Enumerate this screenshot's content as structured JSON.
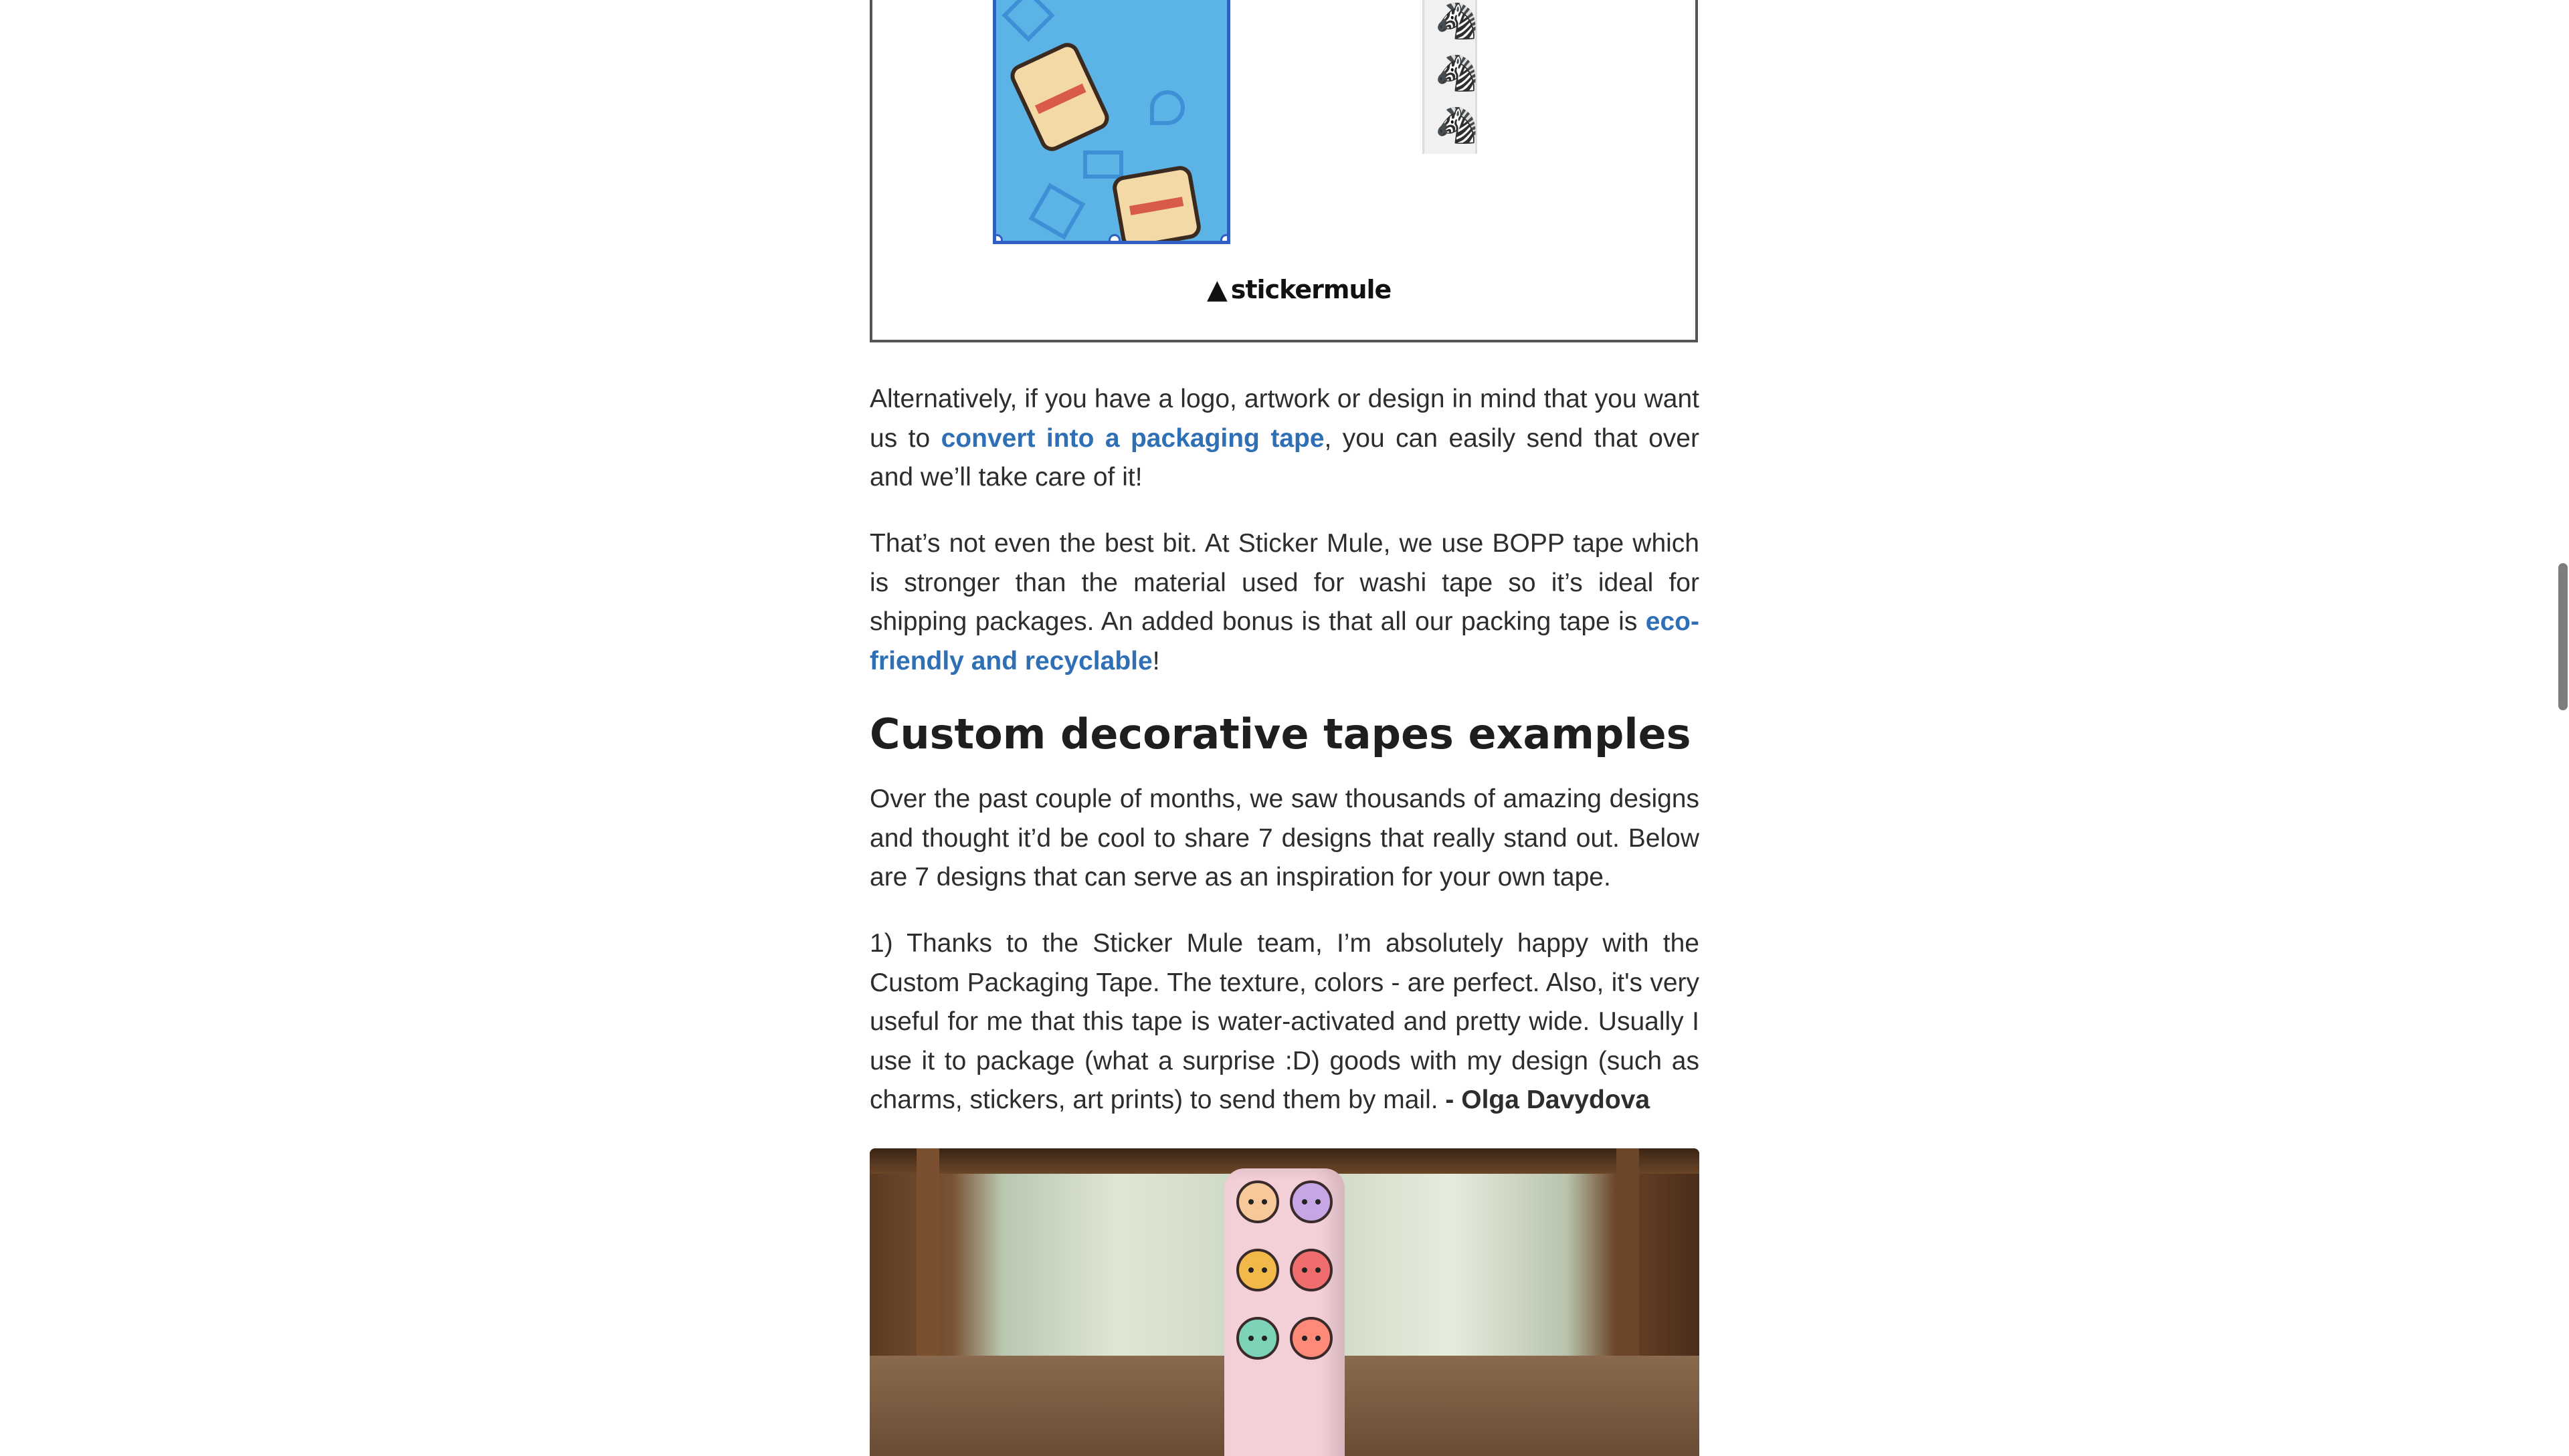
{
  "design_image": {
    "brand_logo_text": "stickermule",
    "logo_icon": "mule-icon",
    "tape_colors": {
      "background": "#5bb3e6",
      "selection": "#2f5fc0"
    }
  },
  "paragraphs": {
    "p1": {
      "before": "Alternatively, if you have a logo, artwork or design in mind that you want us to ",
      "link": "convert into a packaging tape",
      "after": ", you can easily send that over and we’ll take care of it!"
    },
    "p2": {
      "before": "That’s not even the best bit. At Sticker Mule, we use BOPP tape which is stronger than the material used for washi tape so it’s ideal for shipping packages. An added bonus is that all our packing tape is ",
      "link": "eco-friendly and recyclable",
      "after": "!"
    }
  },
  "heading": "Custom decorative tapes examples",
  "p3": "Over the past couple of months, we saw thousands of amazing designs and thought it’d be cool to share 7 designs that really stand out. Below are 7 designs that can serve as an inspiration for your own tape.",
  "p4": {
    "text": "1) Thanks to the Sticker Mule team, I’m absolutely happy with the Custom Packaging Tape. The texture, colors - are perfect. Also, it's very useful for me that this tape is water-activated and pretty wide. Usually I use it to package (what a surprise :D) goods with my design (such as charms, stickers, art prints) to send them by mail. ",
    "author": "- Olga Davydova"
  },
  "colors": {
    "link": "#2f6fb5",
    "text": "#2d2d2d",
    "heading": "#1e1e1e",
    "scroll_thumb": "#7d7d7d"
  },
  "scrollbar": {
    "position_fraction": 0.39
  }
}
